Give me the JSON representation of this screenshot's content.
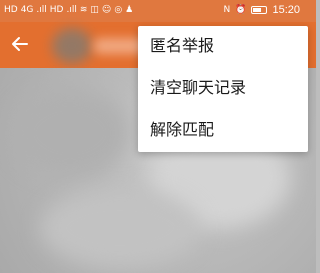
{
  "status_bar": {
    "left_glyphs": [
      "HD",
      "4G",
      ".ıll",
      "HD",
      ".ıll",
      "≋",
      "◫",
      "☺",
      "◎",
      "♟"
    ],
    "right_glyphs": [
      "N",
      "⏰"
    ],
    "time": "15:20"
  },
  "app_bar": {
    "back_icon": "back-arrow-icon"
  },
  "menu": {
    "items": [
      {
        "label": "匿名举报"
      },
      {
        "label": "清空聊天记录"
      },
      {
        "label": "解除匹配"
      }
    ]
  },
  "colors": {
    "accent": "#e36f2f",
    "menu_bg": "#ffffff",
    "content_bg": "#bdbdbd"
  }
}
